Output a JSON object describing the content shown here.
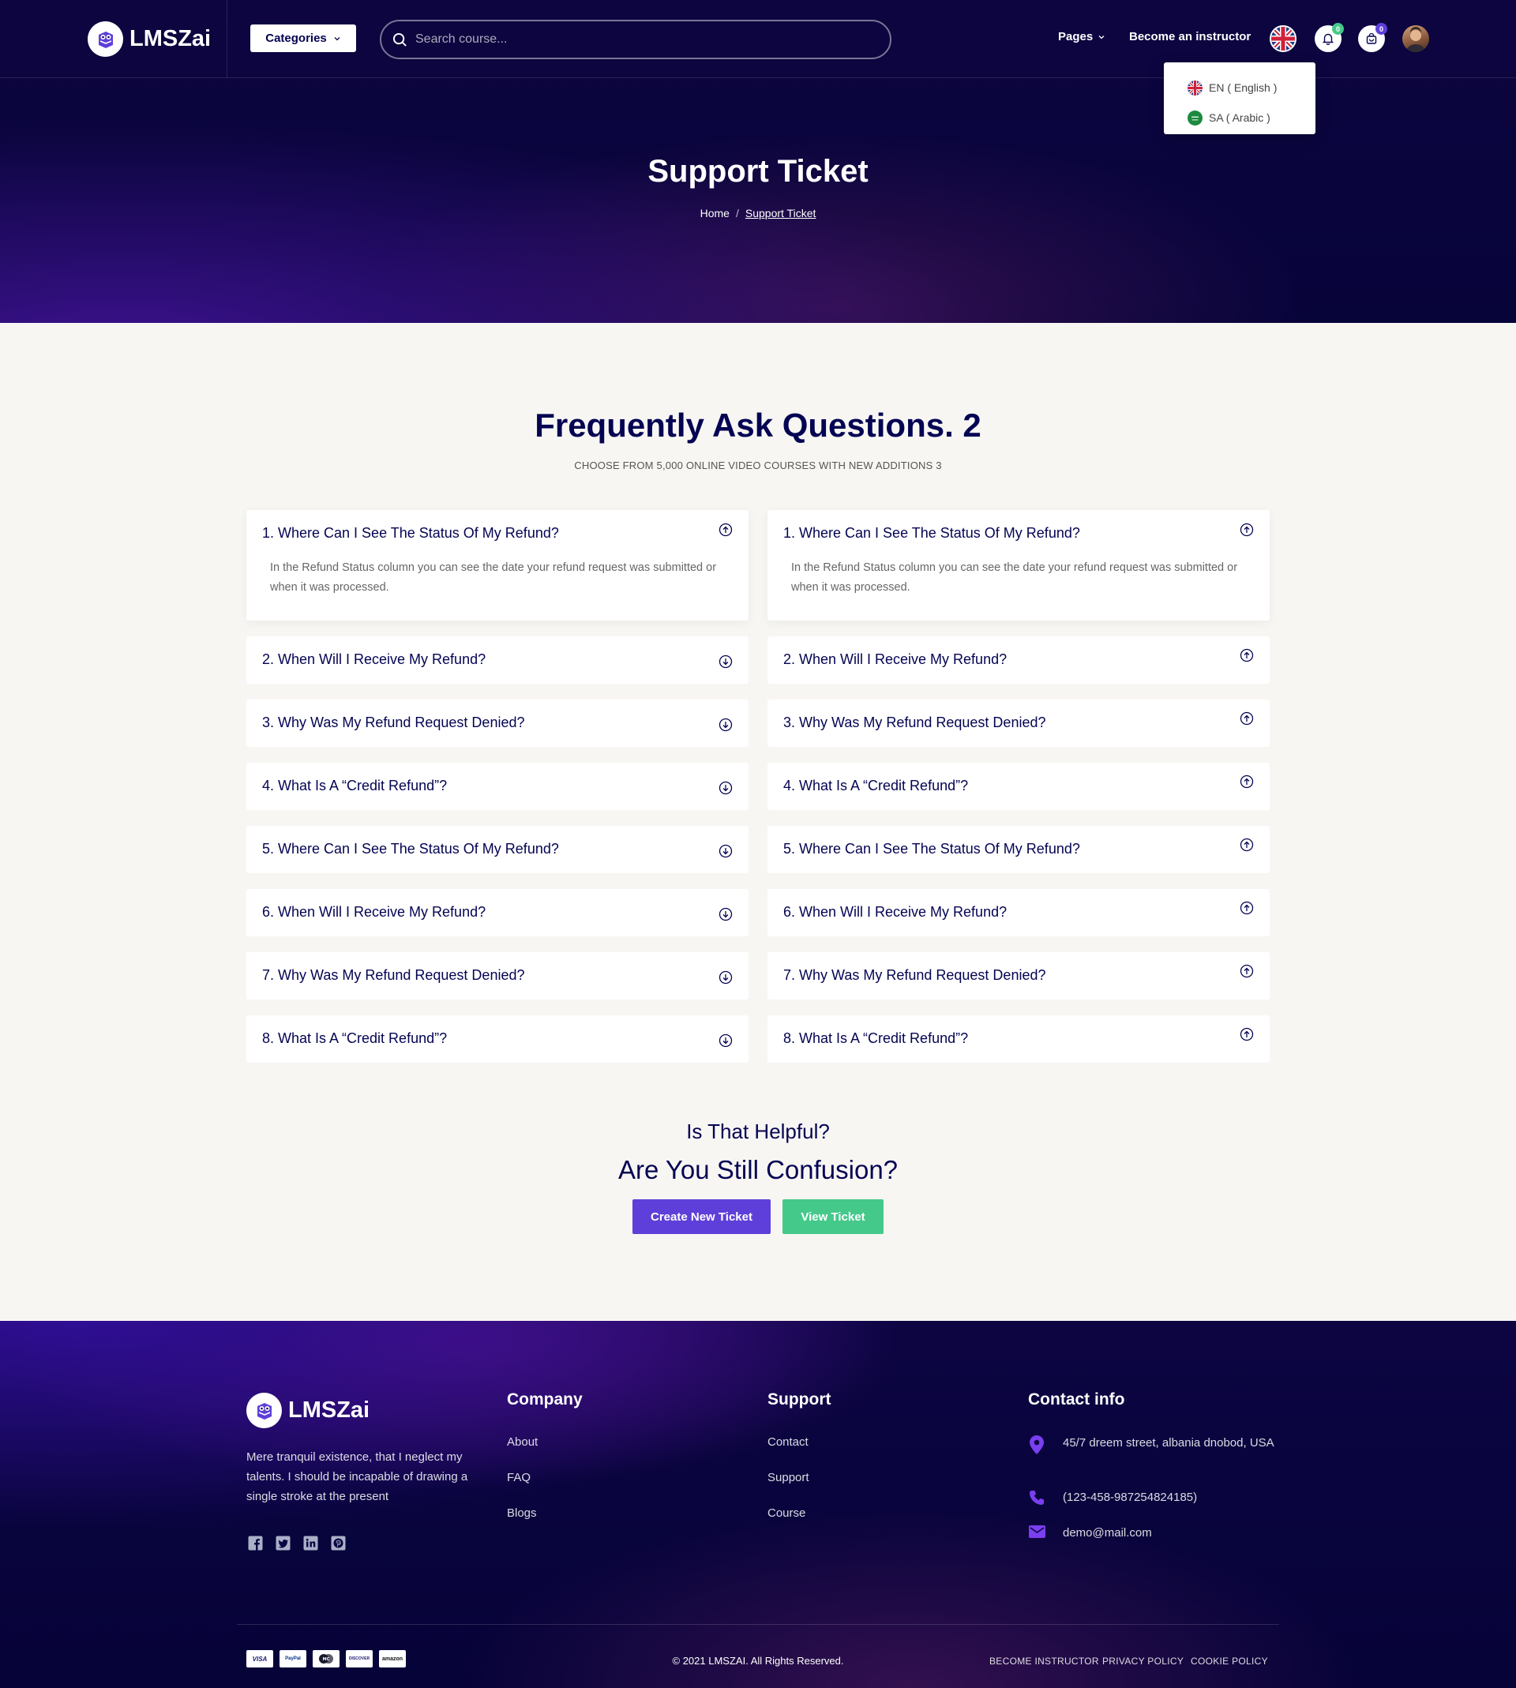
{
  "brand": {
    "name": "LMSZai",
    "logo_icon": "owl-book-icon"
  },
  "header": {
    "categories_label": "Categories",
    "search_placeholder": "Search course...",
    "pages_label": "Pages",
    "instructor_label": "Become an instructor",
    "notification_count": "0",
    "cart_count": "0"
  },
  "language_menu": {
    "items": [
      {
        "code_label": "EN ( English )"
      },
      {
        "code_label": "SA ( Arabic )"
      }
    ]
  },
  "hero": {
    "title": "Support Ticket",
    "breadcrumb": {
      "home": "Home",
      "separator": "/",
      "current": "Support Ticket"
    }
  },
  "faq": {
    "title": "Frequently Ask Questions. 2",
    "subtitle": "CHOOSE FROM 5,000 ONLINE VIDEO COURSES WITH NEW ADDITIONS 3",
    "left": [
      {
        "q": "1. Where Can I See The Status Of My Refund?",
        "a": "In the Refund Status column you can see the date your refund request was submitted or when it was processed."
      },
      {
        "q": "2. When Will I Receive My Refund?"
      },
      {
        "q": "3. Why Was My Refund Request Denied?"
      },
      {
        "q": "4. What Is A “Credit Refund”?"
      },
      {
        "q": "5. Where Can I See The Status Of My Refund?"
      },
      {
        "q": "6. When Will I Receive My Refund?"
      },
      {
        "q": "7. Why Was My Refund Request Denied?"
      },
      {
        "q": "8. What Is A “Credit Refund”?"
      }
    ],
    "right": [
      {
        "q": "1. Where Can I See The Status Of My Refund?",
        "a": "In the Refund Status column you can see the date your refund request was submitted or when it was processed."
      },
      {
        "q": "2. When Will I Receive My Refund?"
      },
      {
        "q": "3. Why Was My Refund Request Denied?"
      },
      {
        "q": "4. What Is A “Credit Refund”?"
      },
      {
        "q": "5. Where Can I See The Status Of My Refund?"
      },
      {
        "q": "6. When Will I Receive My Refund?"
      },
      {
        "q": "7. Why Was My Refund Request Denied?"
      },
      {
        "q": "8. What Is A “Credit Refund”?"
      }
    ]
  },
  "help": {
    "line1": "Is That Helpful?",
    "line2": "Are You Still Confusion?",
    "create_label": "Create New Ticket",
    "view_label": "View Ticket"
  },
  "footer": {
    "about": "Mere tranquil existence, that I neglect my talents. I should be incapable of drawing a single stroke at the present",
    "company": {
      "title": "Company",
      "links": [
        "About",
        "FAQ",
        "Blogs"
      ]
    },
    "support": {
      "title": "Support",
      "links": [
        "Contact",
        "Support",
        "Course"
      ]
    },
    "contact": {
      "title": "Contact info",
      "address": "45/7 dreem street, albania dnobod, USA",
      "phone": "(123-458-987254824185)",
      "email": "demo@mail.com"
    },
    "payment_cards": [
      "VISA",
      "PayPal",
      "MC",
      "DISCOVER",
      "amazon"
    ],
    "copyright": "© 2021 LMSZAI. All Rights Reserved.",
    "bottom_links": [
      "BECOME INSTRUCTOR",
      "PRIVACY POLICY",
      "COOKIE POLICY"
    ]
  },
  "colors": {
    "primary_navy": "#040453",
    "accent_purple": "#5e3fd9",
    "accent_green": "#45c98b",
    "background": "#f8f6f3"
  }
}
